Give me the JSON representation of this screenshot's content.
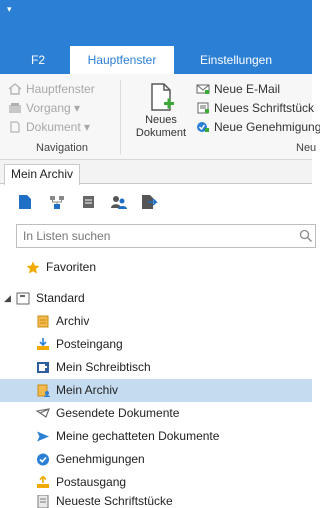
{
  "tabs": {
    "f2": "F2",
    "main": "Hauptfenster",
    "settings": "Einstellungen"
  },
  "navigation": {
    "items": [
      "Hauptfenster",
      "Vorgang ▾",
      "Dokument ▾"
    ],
    "group_label": "Navigation"
  },
  "new_group": {
    "big_button": [
      "Neues",
      "Dokument"
    ],
    "items": [
      "Neue E-Mail",
      "Neues Schriftstück",
      "Neue Genehmigung"
    ],
    "group_label": "Neu"
  },
  "document_tab": "Mein Archiv",
  "search": {
    "placeholder": "In Listen suchen"
  },
  "tree": {
    "favorites": "Favoriten",
    "root": "Standard",
    "items": [
      "Archiv",
      "Posteingang",
      "Mein Schreibtisch",
      "Mein Archiv",
      "Gesendete Dokumente",
      "Meine gechatteten Dokumente",
      "Genehmigungen",
      "Postausgang",
      "Neueste Schriftstücke"
    ],
    "selected_index": 3
  },
  "colors": {
    "accent": "#2b7fd4",
    "selected_row": "#c5dcf0",
    "favorite_star": "#f2a900"
  }
}
